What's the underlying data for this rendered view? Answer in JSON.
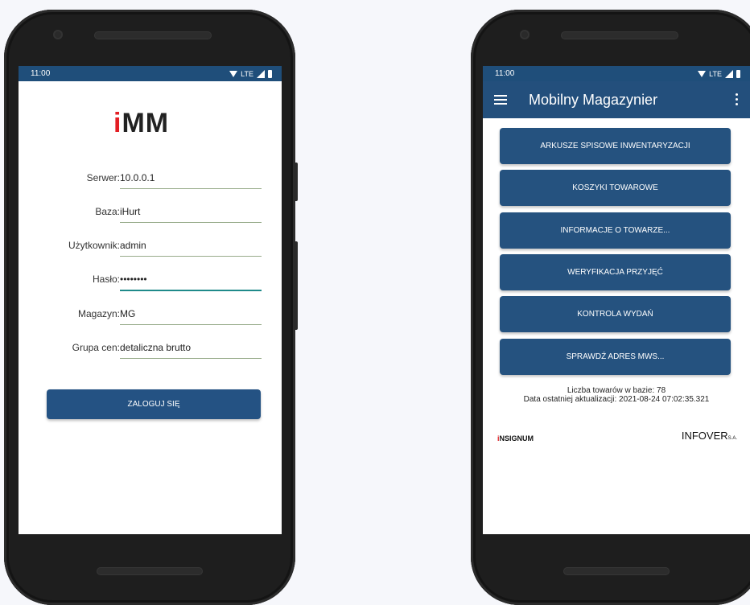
{
  "status": {
    "time": "11:00",
    "network": "LTE"
  },
  "login": {
    "logo": {
      "dot": "i",
      "rest": "MM"
    },
    "fields": [
      {
        "label": "Serwer:",
        "value": "10.0.0.1"
      },
      {
        "label": "Baza:",
        "value": "iHurt"
      },
      {
        "label": "Użytkownik:",
        "value": "admin"
      },
      {
        "label": "Hasło:",
        "value": "••••••••"
      },
      {
        "label": "Magazyn:",
        "value": "MG"
      },
      {
        "label": "Grupa cen:",
        "value": "detaliczna brutto"
      }
    ],
    "login_button": "ZALOGUJ SIĘ"
  },
  "main": {
    "title": "Mobilny Magazynier",
    "buttons": [
      "ARKUSZE SPISOWE INWENTARYZACJI",
      "KOSZYKI TOWAROWE",
      "INFORMACJE O TOWARZE...",
      "WERYFIKACJA PRZYJĘĆ",
      "KONTROLA WYDAŃ",
      "SPRAWDŹ ADRES MWS..."
    ],
    "info_count": "Liczba towarów w bazie: 78",
    "info_update": "Data ostatniej aktualizacji: 2021-08-24 07:02:35.321",
    "brand_left_i": "i",
    "brand_left_rest": "NSIGNUM",
    "brand_right": "INFOVER",
    "brand_right_suffix": "S.A."
  }
}
